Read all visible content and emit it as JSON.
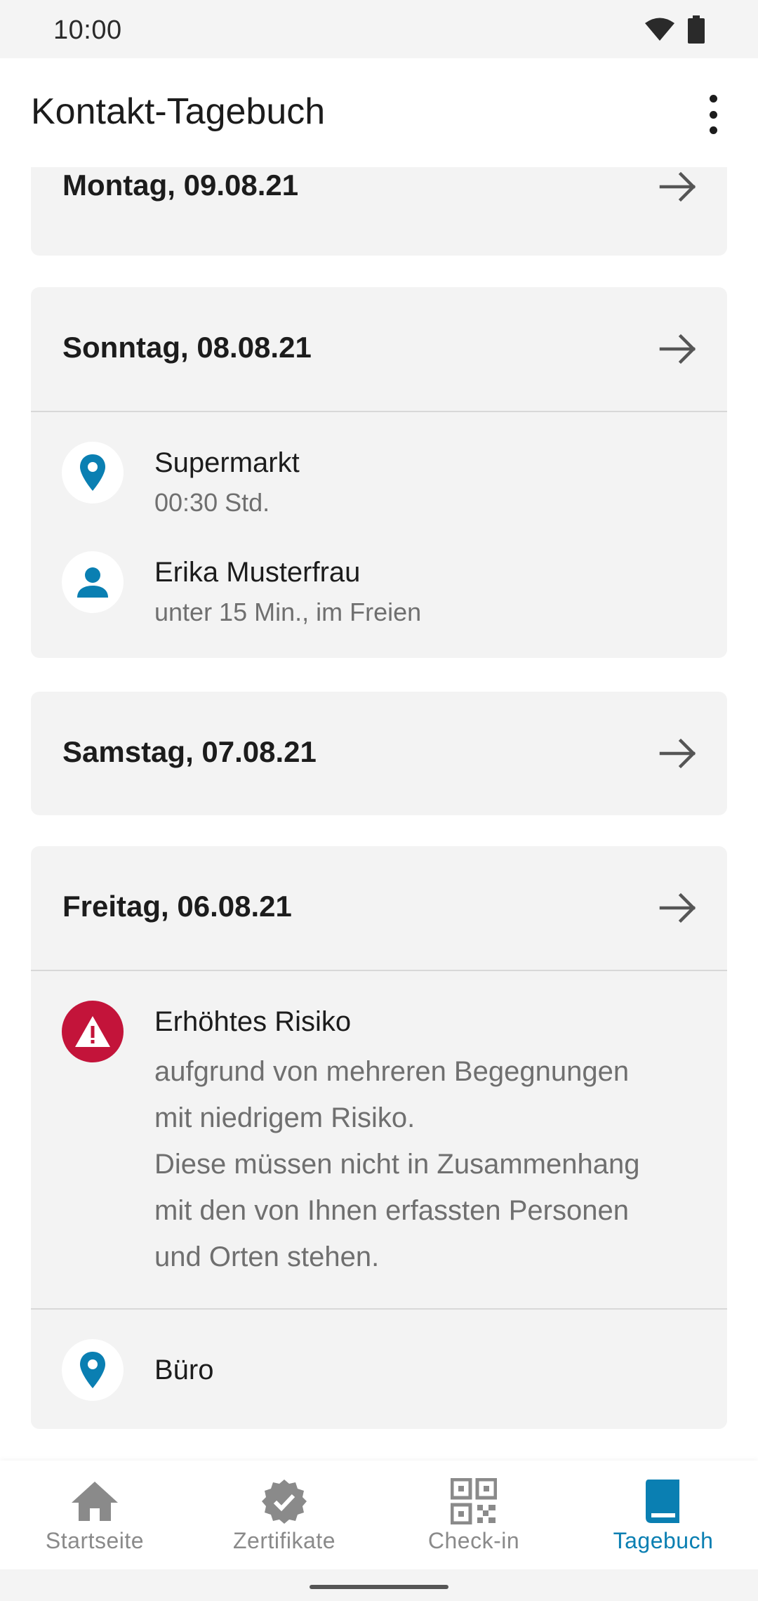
{
  "status_bar": {
    "time": "10:00",
    "icons": [
      "wifi-icon",
      "battery-icon"
    ]
  },
  "app_bar": {
    "title": "Kontakt-Tagebuch",
    "menu_icon": "more-vert-icon"
  },
  "days": [
    {
      "date": "Montag, 09.08.21",
      "entries": []
    },
    {
      "date": "Sonntag, 08.08.21",
      "entries": [
        {
          "type": "location",
          "icon": "location-pin-icon",
          "name": "Supermarkt",
          "detail": "00:30 Std."
        },
        {
          "type": "person",
          "icon": "person-icon",
          "name": "Erika Musterfrau",
          "detail": "unter 15 Min., im Freien"
        }
      ]
    },
    {
      "date": "Samstag, 07.08.21",
      "entries": []
    },
    {
      "date": "Freitag, 06.08.21",
      "risk": {
        "icon": "warning-icon",
        "title": "Erhöhtes Risiko",
        "lines": [
          "aufgrund von mehreren Begegnungen",
          "mit niedrigem Risiko.",
          "Diese müssen nicht in Zusammenhang",
          "mit den von Ihnen erfassten Personen",
          "und Orten stehen."
        ]
      },
      "entries": [
        {
          "type": "location",
          "icon": "location-pin-icon",
          "name": "Büro"
        }
      ]
    }
  ],
  "bottom_nav": {
    "items": [
      {
        "label": "Startseite",
        "icon": "home-icon",
        "active": false
      },
      {
        "label": "Zertifikate",
        "icon": "certificate-icon",
        "active": false
      },
      {
        "label": "Check-in",
        "icon": "qr-code-icon",
        "active": false
      },
      {
        "label": "Tagebuch",
        "icon": "book-icon",
        "active": true
      }
    ]
  },
  "colors": {
    "accent": "#0a7fb2",
    "risk": "#c3143a",
    "card_bg": "#f3f3f3",
    "text_primary": "#1c1c1c",
    "text_secondary": "#6f6f6f",
    "inactive": "#8a8a8a"
  }
}
